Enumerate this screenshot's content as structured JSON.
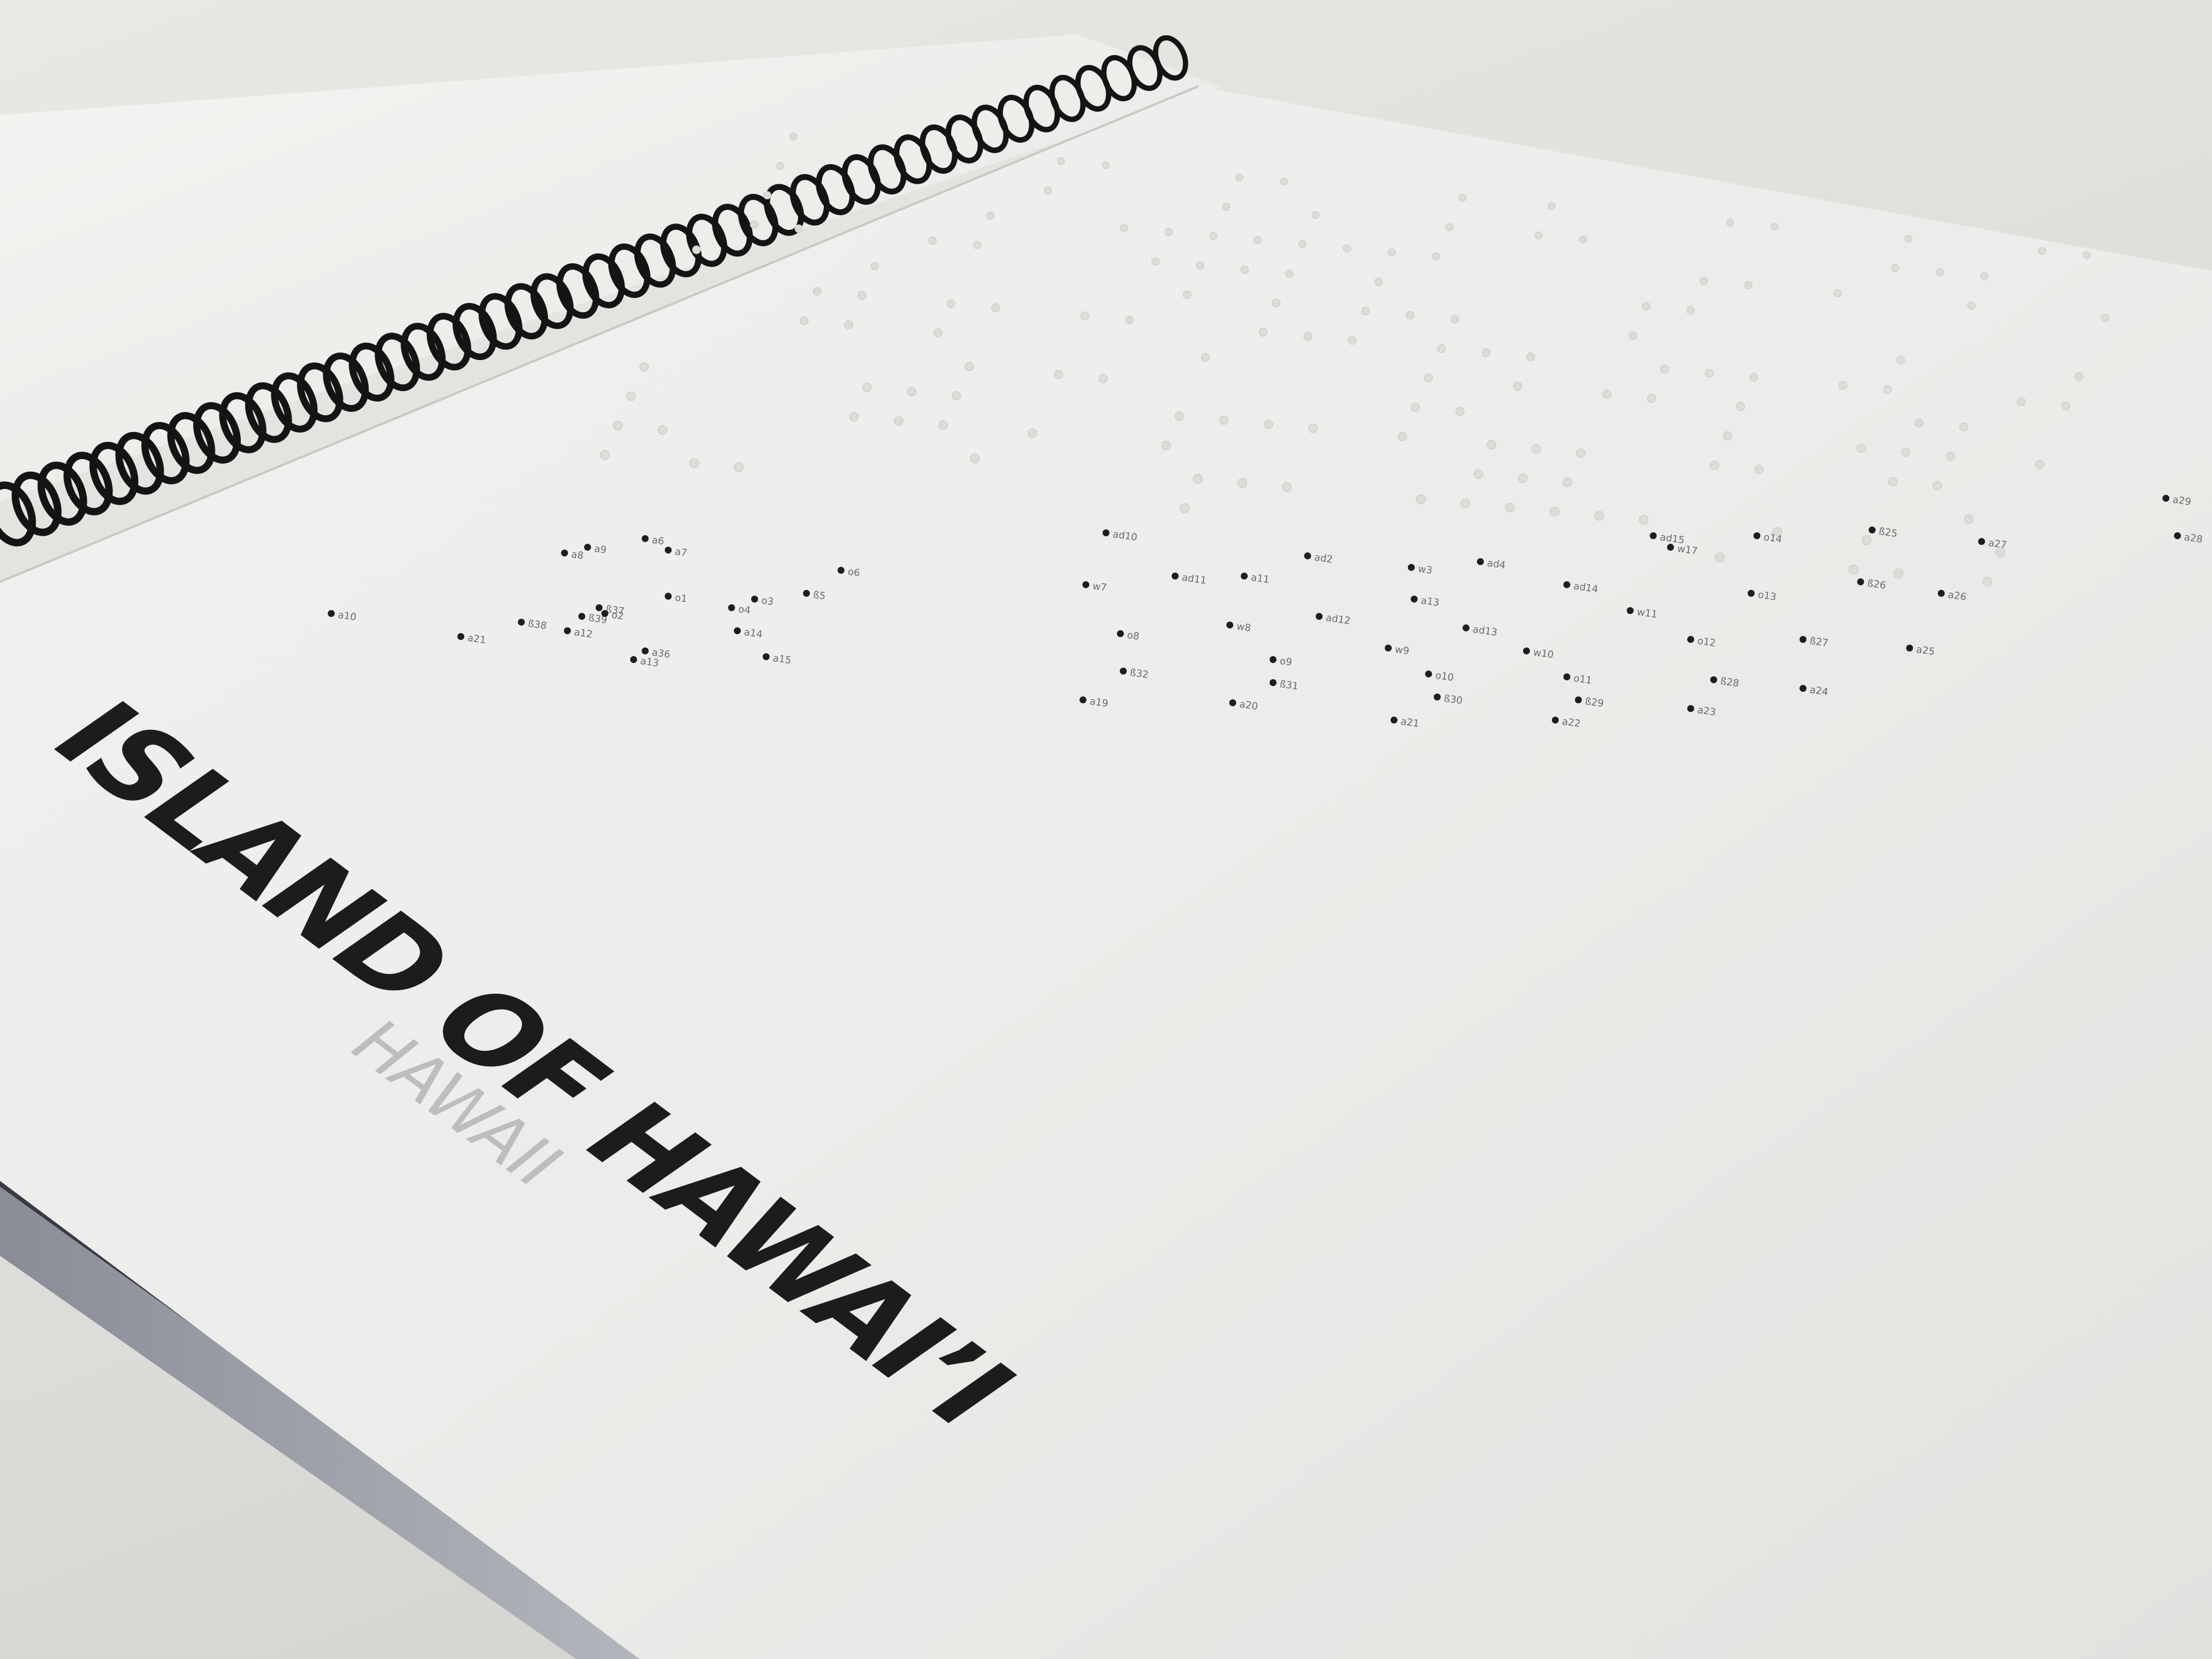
{
  "book": {
    "title": "ISLAND OF HAWAI’I",
    "subtitle": "HAWAII"
  },
  "map_labels": [
    {
      "text": "a10"
    },
    {
      "text": "a21"
    },
    {
      "text": "ß38"
    },
    {
      "text": "a12"
    },
    {
      "text": "a14"
    },
    {
      "text": "a15"
    },
    {
      "text": "a36"
    },
    {
      "text": "a13"
    },
    {
      "text": "ß39"
    },
    {
      "text": "ß37"
    },
    {
      "text": "o2"
    },
    {
      "text": "o1"
    },
    {
      "text": "o4"
    },
    {
      "text": "o3"
    },
    {
      "text": "ß5"
    },
    {
      "text": "a8"
    },
    {
      "text": "a9"
    },
    {
      "text": "a6"
    },
    {
      "text": "a7"
    },
    {
      "text": "o6"
    },
    {
      "text": "o8"
    },
    {
      "text": "ß32"
    },
    {
      "text": "a19"
    },
    {
      "text": "o9"
    },
    {
      "text": "ß31"
    },
    {
      "text": "a20"
    },
    {
      "text": "w8"
    },
    {
      "text": "ad11"
    },
    {
      "text": "ad12"
    },
    {
      "text": "w9"
    },
    {
      "text": "o10"
    },
    {
      "text": "ß30"
    },
    {
      "text": "a21"
    },
    {
      "text": "ad13"
    },
    {
      "text": "w10"
    },
    {
      "text": "o11"
    },
    {
      "text": "ß29"
    },
    {
      "text": "a22"
    },
    {
      "text": "w11"
    },
    {
      "text": "o12"
    },
    {
      "text": "ß28"
    },
    {
      "text": "a23"
    },
    {
      "text": "ß27"
    },
    {
      "text": "a24"
    },
    {
      "text": "a25"
    },
    {
      "text": "a26"
    },
    {
      "text": "ß26"
    },
    {
      "text": "a13"
    },
    {
      "text": "ad14"
    },
    {
      "text": "o13"
    },
    {
      "text": "w3"
    },
    {
      "text": "ad4"
    },
    {
      "text": "ad10"
    },
    {
      "text": "w7"
    },
    {
      "text": "a11"
    },
    {
      "text": "ad2"
    },
    {
      "text": "ad15"
    },
    {
      "text": "w17"
    },
    {
      "text": "o14"
    },
    {
      "text": "ß25"
    },
    {
      "text": "a27"
    },
    {
      "text": "a28"
    },
    {
      "text": "a29"
    }
  ]
}
